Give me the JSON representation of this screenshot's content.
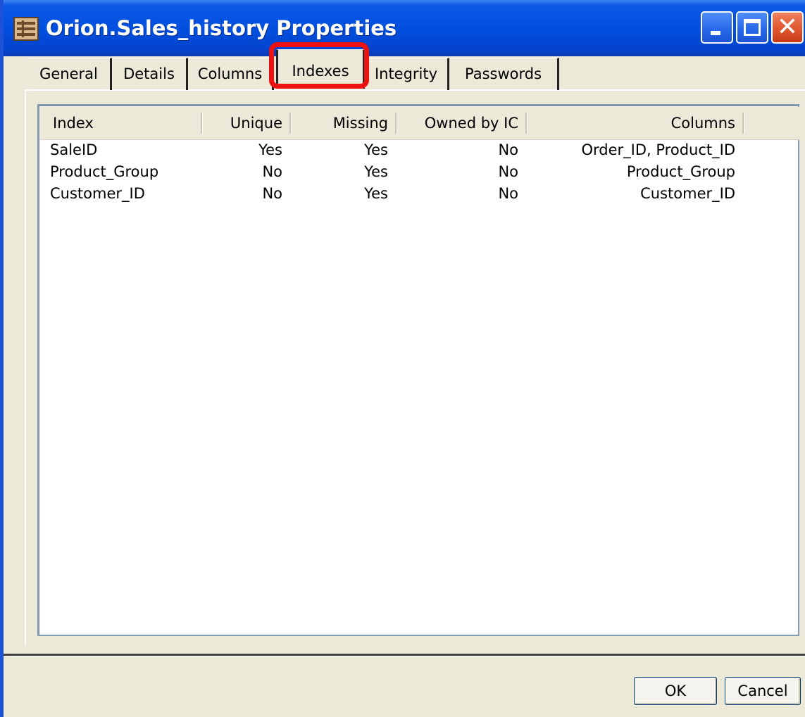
{
  "window": {
    "title": "Orion.Sales_history Properties",
    "title_icon": "table-properties-icon",
    "controls": {
      "minimize": "minimize-icon",
      "maximize": "maximize-icon",
      "close": "close-icon"
    }
  },
  "tabs": [
    {
      "label": "General"
    },
    {
      "label": "Details"
    },
    {
      "label": "Columns"
    },
    {
      "label": "Indexes",
      "active": true
    },
    {
      "label": "Integrity"
    },
    {
      "label": "Passwords"
    }
  ],
  "highlight_color": "#ee1111",
  "index_list": {
    "columns": [
      "Index",
      "Unique",
      "Missing",
      "Owned by IC",
      "Columns"
    ],
    "rows": [
      [
        "SaleID",
        "Yes",
        "Yes",
        "No",
        "Order_ID, Product_ID"
      ],
      [
        "Product_Group",
        "No",
        "Yes",
        "No",
        "Product_Group"
      ],
      [
        "Customer_ID",
        "No",
        "Yes",
        "No",
        "Customer_ID"
      ]
    ]
  },
  "buttons": {
    "ok": "OK",
    "cancel": "Cancel"
  }
}
